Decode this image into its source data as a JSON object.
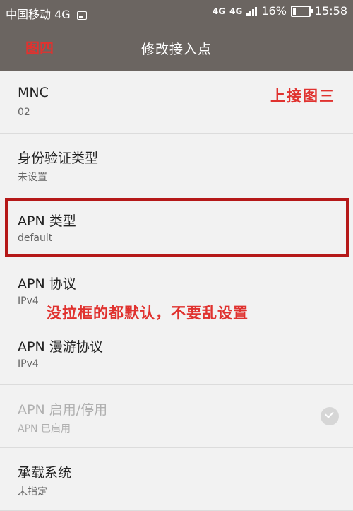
{
  "status_bar": {
    "carrier": "中国移动 4G",
    "network1": "4G",
    "network2": "4G",
    "battery_text": "16%",
    "battery_level": 0.16,
    "time": "15:58"
  },
  "header": {
    "annotation": "图四",
    "title": "修改接入点"
  },
  "annotations": {
    "right_note": "上接图三",
    "middle_note": "没拉框的都默认，不要乱设置"
  },
  "items": [
    {
      "title": "MNC",
      "value": "02"
    },
    {
      "title": "身份验证类型",
      "value": "未设置"
    },
    {
      "title": "APN 类型",
      "value": "default"
    },
    {
      "title": "APN 协议",
      "value": "IPv4"
    },
    {
      "title": "APN 漫游协议",
      "value": "IPv4"
    },
    {
      "title": "APN 启用/停用",
      "value": "APN 已启用"
    },
    {
      "title": "承载系统",
      "value": "未指定"
    }
  ],
  "colors": {
    "header_bg": "#6b6561",
    "annotation_red": "#e0322f",
    "highlight_border": "#b51818"
  }
}
